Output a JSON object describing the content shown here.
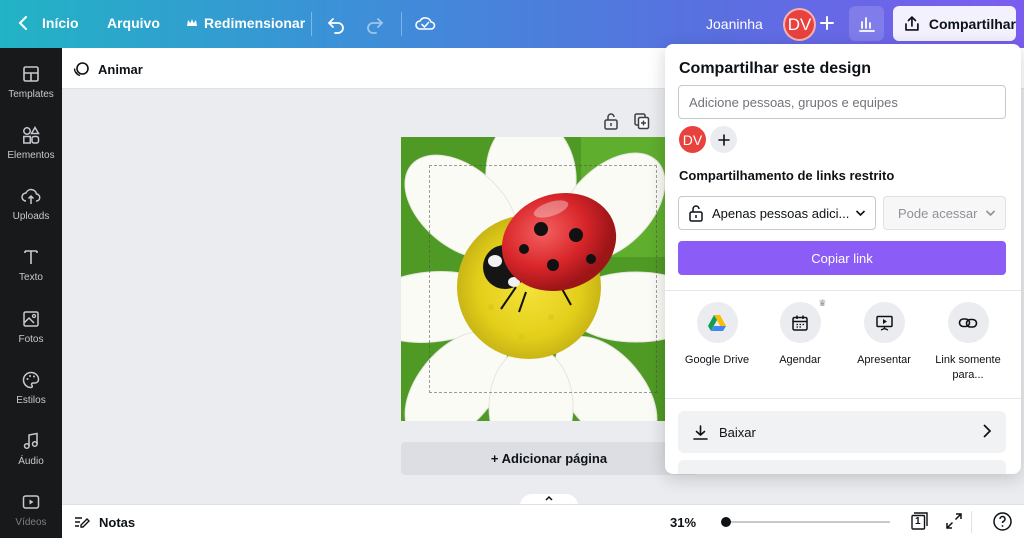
{
  "topbar": {
    "back_label": "Início",
    "file_label": "Arquivo",
    "resize_label": "Redimensionar",
    "design_name": "Joaninha",
    "avatar_initials": "DV",
    "share_label": "Compartilhar"
  },
  "sidebar": {
    "items": [
      {
        "label": "Templates",
        "icon": "templates-icon"
      },
      {
        "label": "Elementos",
        "icon": "elements-icon"
      },
      {
        "label": "Uploads",
        "icon": "upload-icon"
      },
      {
        "label": "Texto",
        "icon": "text-icon"
      },
      {
        "label": "Fotos",
        "icon": "photos-icon"
      },
      {
        "label": "Estilos",
        "icon": "palette-icon"
      },
      {
        "label": "Áudio",
        "icon": "music-icon"
      },
      {
        "label": "Vídeos",
        "icon": "video-icon"
      }
    ]
  },
  "subbar": {
    "animate_label": "Animar"
  },
  "canvas": {
    "add_page_label": "+ Adicionar página"
  },
  "bottombar": {
    "notes_label": "Notas",
    "zoom": "31%",
    "page_count": "1"
  },
  "share_panel": {
    "title": "Compartilhar este design",
    "people_placeholder": "Adicione pessoas, grupos e equipes",
    "avatar_initials": "DV",
    "restricted_label": "Compartilhamento de links restrito",
    "access_value": "Apenas pessoas adici...",
    "permission_value": "Pode acessar",
    "copy_link_label": "Copiar link",
    "options": [
      {
        "label": "Google Drive",
        "icon": "google-drive-icon"
      },
      {
        "label": "Agendar",
        "icon": "calendar-icon"
      },
      {
        "label": "Apresentar",
        "icon": "present-icon"
      },
      {
        "label": "Link somente para...",
        "icon": "link-icon"
      }
    ],
    "download_label": "Baixar"
  },
  "colors": {
    "accent": "#8b5cf6",
    "avatar": "#e8423f",
    "sidebar_bg": "#18191b"
  }
}
